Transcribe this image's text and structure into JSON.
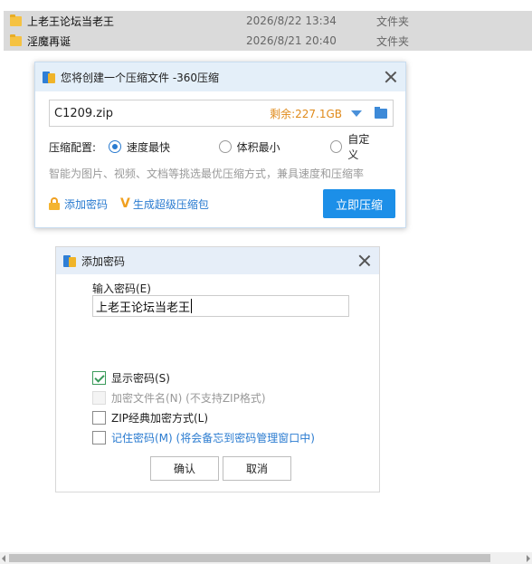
{
  "file_list": [
    {
      "name": "上老王论坛当老王",
      "modified": "2026/8/22 13:34",
      "type": "文件夹"
    },
    {
      "name": "淫魔再诞",
      "modified": "2026/8/21 20:40",
      "type": "文件夹"
    }
  ],
  "compress_dialog": {
    "title": "您将创建一个压缩文件 -360压缩",
    "filename": "C1209.zip",
    "free_space": "剩余:227.1GB",
    "config_label": "压缩配置:",
    "options": [
      "速度最快",
      "体积最小",
      "自定义"
    ],
    "selected_option": "速度最快",
    "hint": "智能为图片、视频、文档等挑选最优压缩方式，兼具速度和压缩率",
    "add_password_link": "添加密码",
    "super_zip_link": "生成超级压缩包",
    "compress_button": "立即压缩"
  },
  "password_dialog": {
    "title": "添加密码",
    "input_label": "输入密码(E)",
    "password_value": "上老王论坛当老王",
    "show_password": "显示密码(S)",
    "encrypt_filenames": "加密文件名(N) (不支持ZIP格式)",
    "zip_classic": "ZIP经典加密方式(L)",
    "remember_password": "记住密码(M) (将会备忘到密码管理窗口中)",
    "ok_button": "确认",
    "cancel_button": "取消",
    "show_password_checked": true,
    "encrypt_filenames_checked": false,
    "zip_classic_checked": false,
    "remember_password_checked": false
  }
}
